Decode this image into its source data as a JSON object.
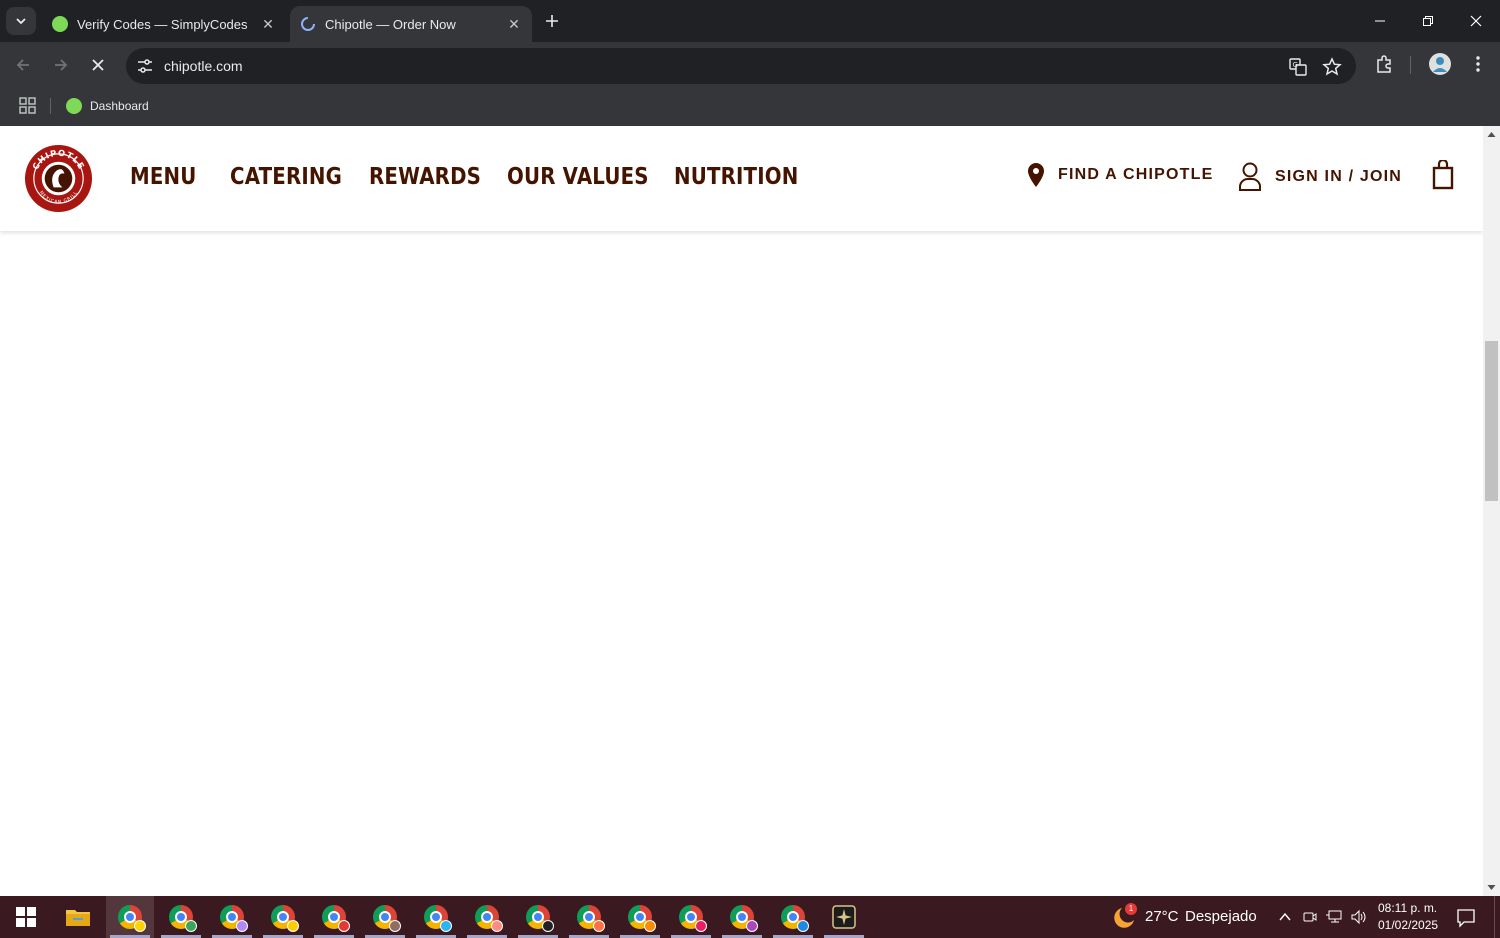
{
  "browser": {
    "tabs": [
      {
        "title": "Verify Codes — SimplyCodes",
        "favicon_color": "#7ed957",
        "active": false
      },
      {
        "title": "Chipotle — Order Now",
        "favicon_color": "#8ab4f8",
        "active": true
      }
    ],
    "url": "chipotle.com",
    "bookmarks": [
      {
        "label": "Dashboard",
        "favicon_color": "#7ed957"
      }
    ]
  },
  "site": {
    "logo_text": "CHIPOTLE MEXICAN GRILL",
    "nav": [
      "MENU",
      "CATERING",
      "REWARDS",
      "OUR VALUES",
      "NUTRITION"
    ],
    "find_label": "FIND A CHIPOTLE",
    "signin_label": "SIGN IN / JOIN",
    "brand_color": "#451400",
    "logo_color": "#a81612"
  },
  "taskbar": {
    "weather_temp": "27°C",
    "weather_desc": "Despejado",
    "weather_badge": "1",
    "time": "08:11 p. m.",
    "date": "01/02/2025",
    "app_badges": [
      "#ffd200",
      "#3ba55d",
      "#b088f9",
      "#ffcc00",
      "#e53935",
      "#8d6e63",
      "#29b6f6",
      "#ff8a80",
      "#212121",
      "#ff7043",
      "#fb8c00",
      "#e91e63",
      "#ab47bc",
      "#1e88e5"
    ]
  }
}
